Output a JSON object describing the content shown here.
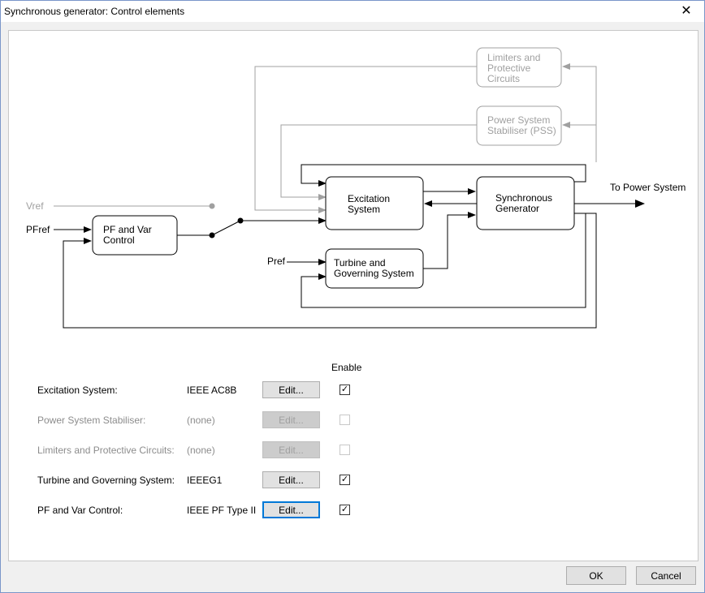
{
  "window": {
    "title": "Synchronous generator: Control elements",
    "close_glyph": "✕"
  },
  "diagram": {
    "blocks": {
      "limiters": [
        "Limiters and",
        "Protective",
        "Circuits"
      ],
      "pss": [
        "Power System",
        "Stabiliser (PSS)"
      ],
      "excitation": [
        "Excitation",
        "System"
      ],
      "generator": [
        "Synchronous",
        "Generator"
      ],
      "pfvar": [
        "PF and Var",
        "Control"
      ],
      "turbine": [
        "Turbine and",
        "Governing System"
      ]
    },
    "labels": {
      "vref": "Vref",
      "pfref": "PFref",
      "pref": "Pref",
      "to_power_system": "To Power System"
    },
    "colors": {
      "active": "#000000",
      "inactive": "#a0a0a0"
    }
  },
  "table": {
    "enable_header": "Enable",
    "rows": [
      {
        "label": "Excitation System:",
        "model": "IEEE AC8B",
        "edit": "Edit...",
        "enabled": true,
        "available": true
      },
      {
        "label": "Power System Stabiliser:",
        "model": "(none)",
        "edit": "Edit...",
        "enabled": false,
        "available": false
      },
      {
        "label": "Limiters and Protective Circuits:",
        "model": "(none)",
        "edit": "Edit...",
        "enabled": false,
        "available": false
      },
      {
        "label": "Turbine and Governing System:",
        "model": "IEEEG1",
        "edit": "Edit...",
        "enabled": true,
        "available": true
      },
      {
        "label": "PF and Var Control:",
        "model": "IEEE PF Type II",
        "edit": "Edit...",
        "enabled": true,
        "available": true
      }
    ]
  },
  "buttons": {
    "ok": "OK",
    "cancel": "Cancel"
  },
  "check_glyph": "✓"
}
